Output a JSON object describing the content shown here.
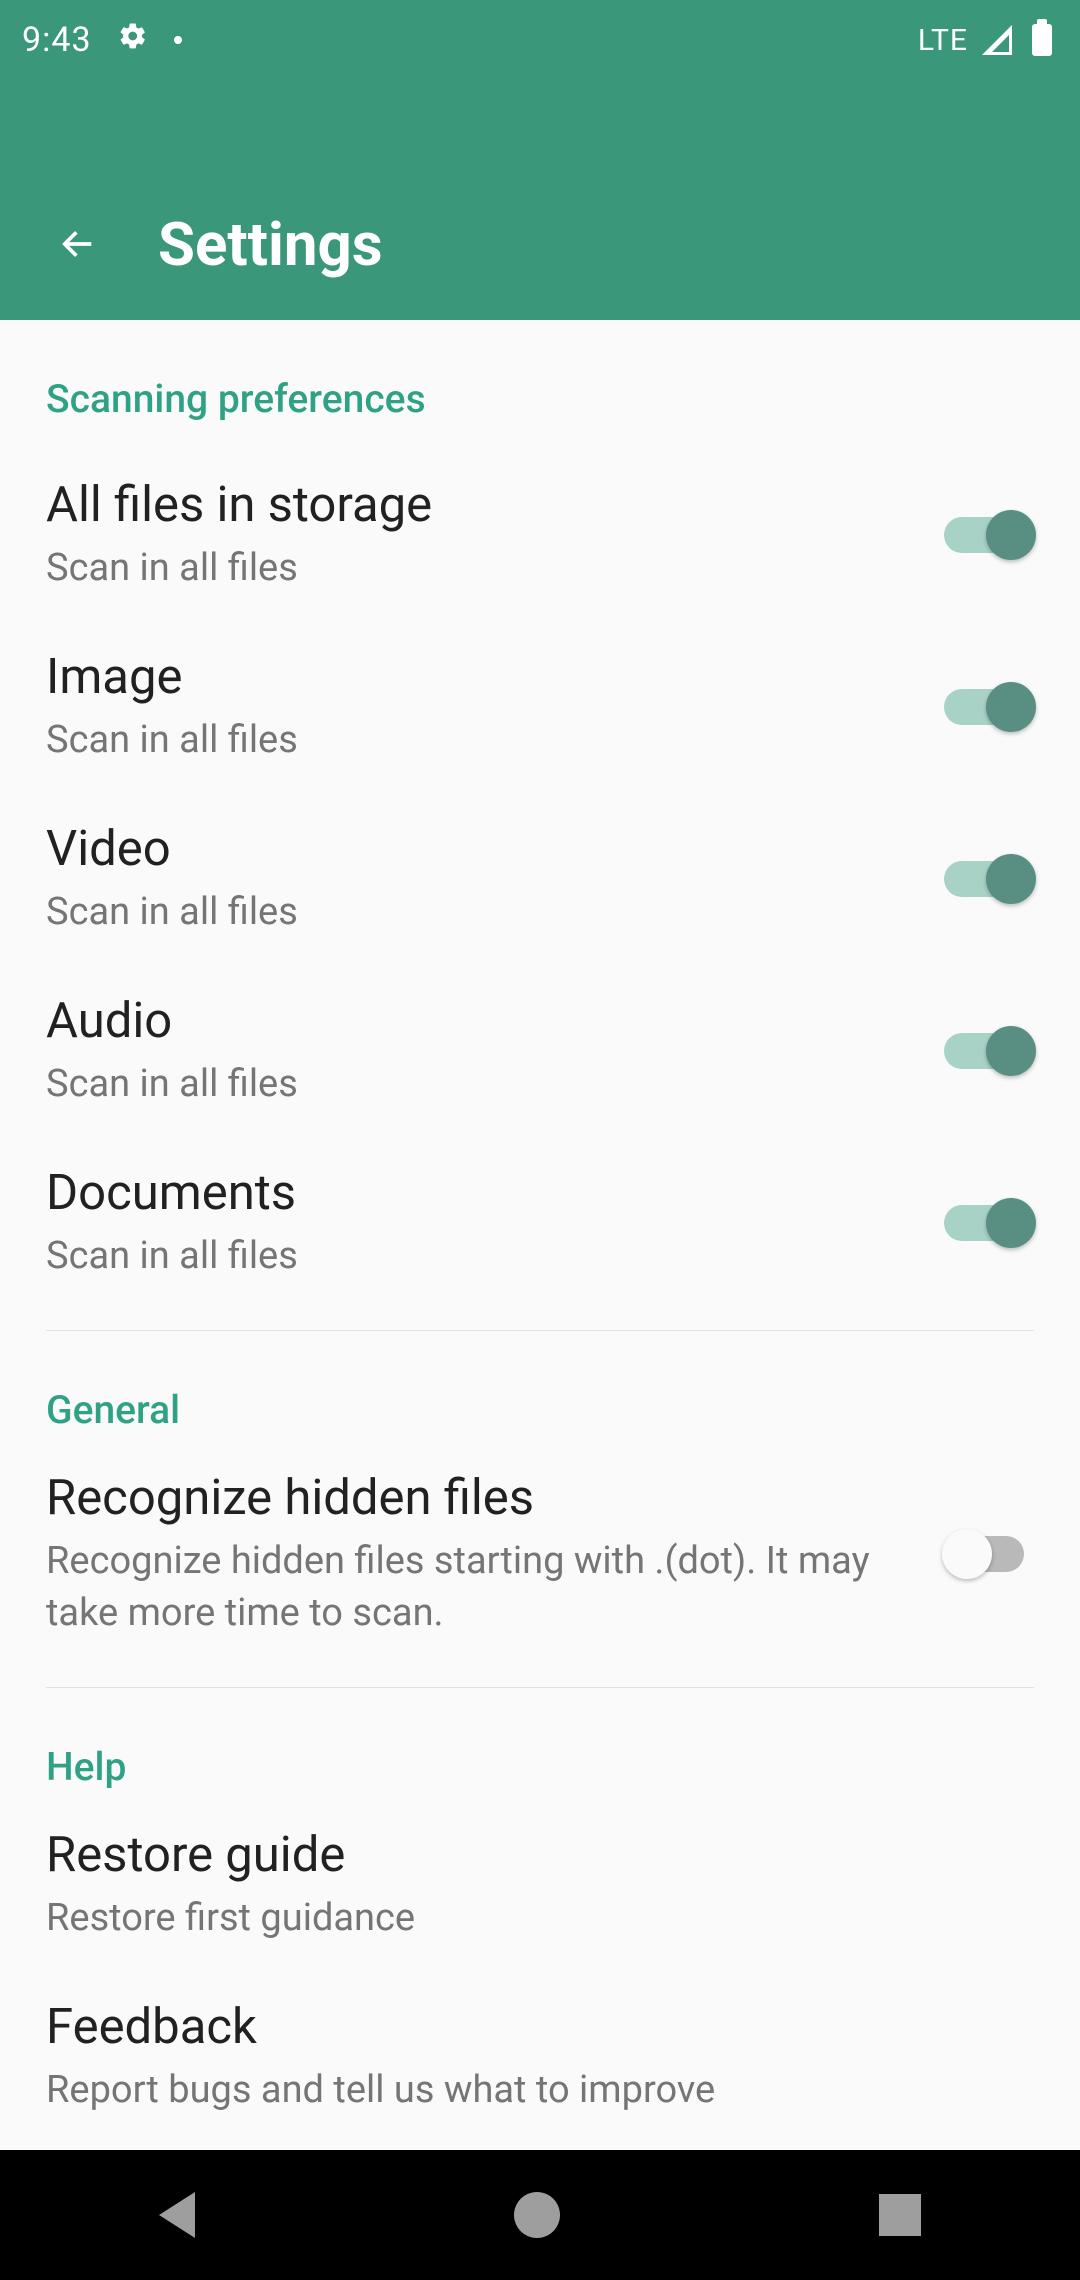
{
  "status": {
    "time": "9:43",
    "network": "LTE"
  },
  "header": {
    "title": "Settings"
  },
  "sections": {
    "scanning": {
      "header": "Scanning preferences",
      "allfiles": {
        "title": "All files in storage",
        "sub": "Scan in all files"
      },
      "image": {
        "title": "Image",
        "sub": "Scan in all files"
      },
      "video": {
        "title": "Video",
        "sub": "Scan in all files"
      },
      "audio": {
        "title": "Audio",
        "sub": "Scan in all files"
      },
      "documents": {
        "title": "Documents",
        "sub": "Scan in all files"
      }
    },
    "general": {
      "header": "General",
      "hidden": {
        "title": "Recognize hidden files",
        "sub": "Recognize hidden files starting with .(dot). It may take more time to scan."
      }
    },
    "help": {
      "header": "Help",
      "restore": {
        "title": "Restore guide",
        "sub": "Restore first guidance"
      },
      "feedback": {
        "title": "Feedback",
        "sub": "Report bugs and tell us what to improve"
      }
    }
  }
}
